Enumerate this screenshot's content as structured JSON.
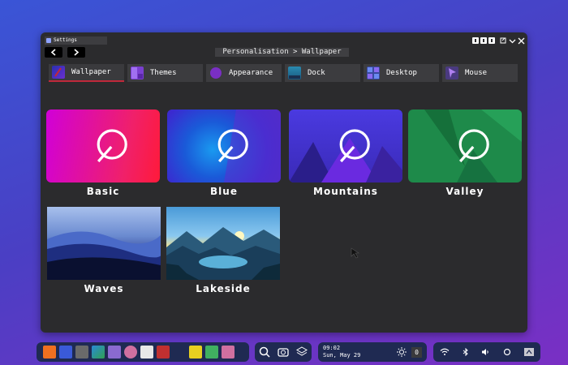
{
  "window": {
    "title": "Settings",
    "breadcrumb": "Personalisation > Wallpaper"
  },
  "tabs": [
    {
      "label": "Wallpaper",
      "icon": "wallpaper-icon",
      "active": true
    },
    {
      "label": "Themes",
      "icon": "themes-icon"
    },
    {
      "label": "Appearance",
      "icon": "appearance-icon"
    },
    {
      "label": "Dock",
      "icon": "dock-icon"
    },
    {
      "label": "Desktop",
      "icon": "desktop-icon"
    },
    {
      "label": "Mouse",
      "icon": "mouse-icon"
    }
  ],
  "wallpapers": [
    {
      "label": "Basic"
    },
    {
      "label": "Blue"
    },
    {
      "label": "Mountains"
    },
    {
      "label": "Valley"
    },
    {
      "label": "Waves"
    },
    {
      "label": "Lakeside"
    }
  ],
  "taskbar": {
    "time": "09:02",
    "date": "Sun, May 29",
    "notification_count": "0"
  },
  "colors": {
    "accent": "#c0283a",
    "window_bg": "#2b2b2d",
    "taskbar_bg": "#1f2a52"
  }
}
